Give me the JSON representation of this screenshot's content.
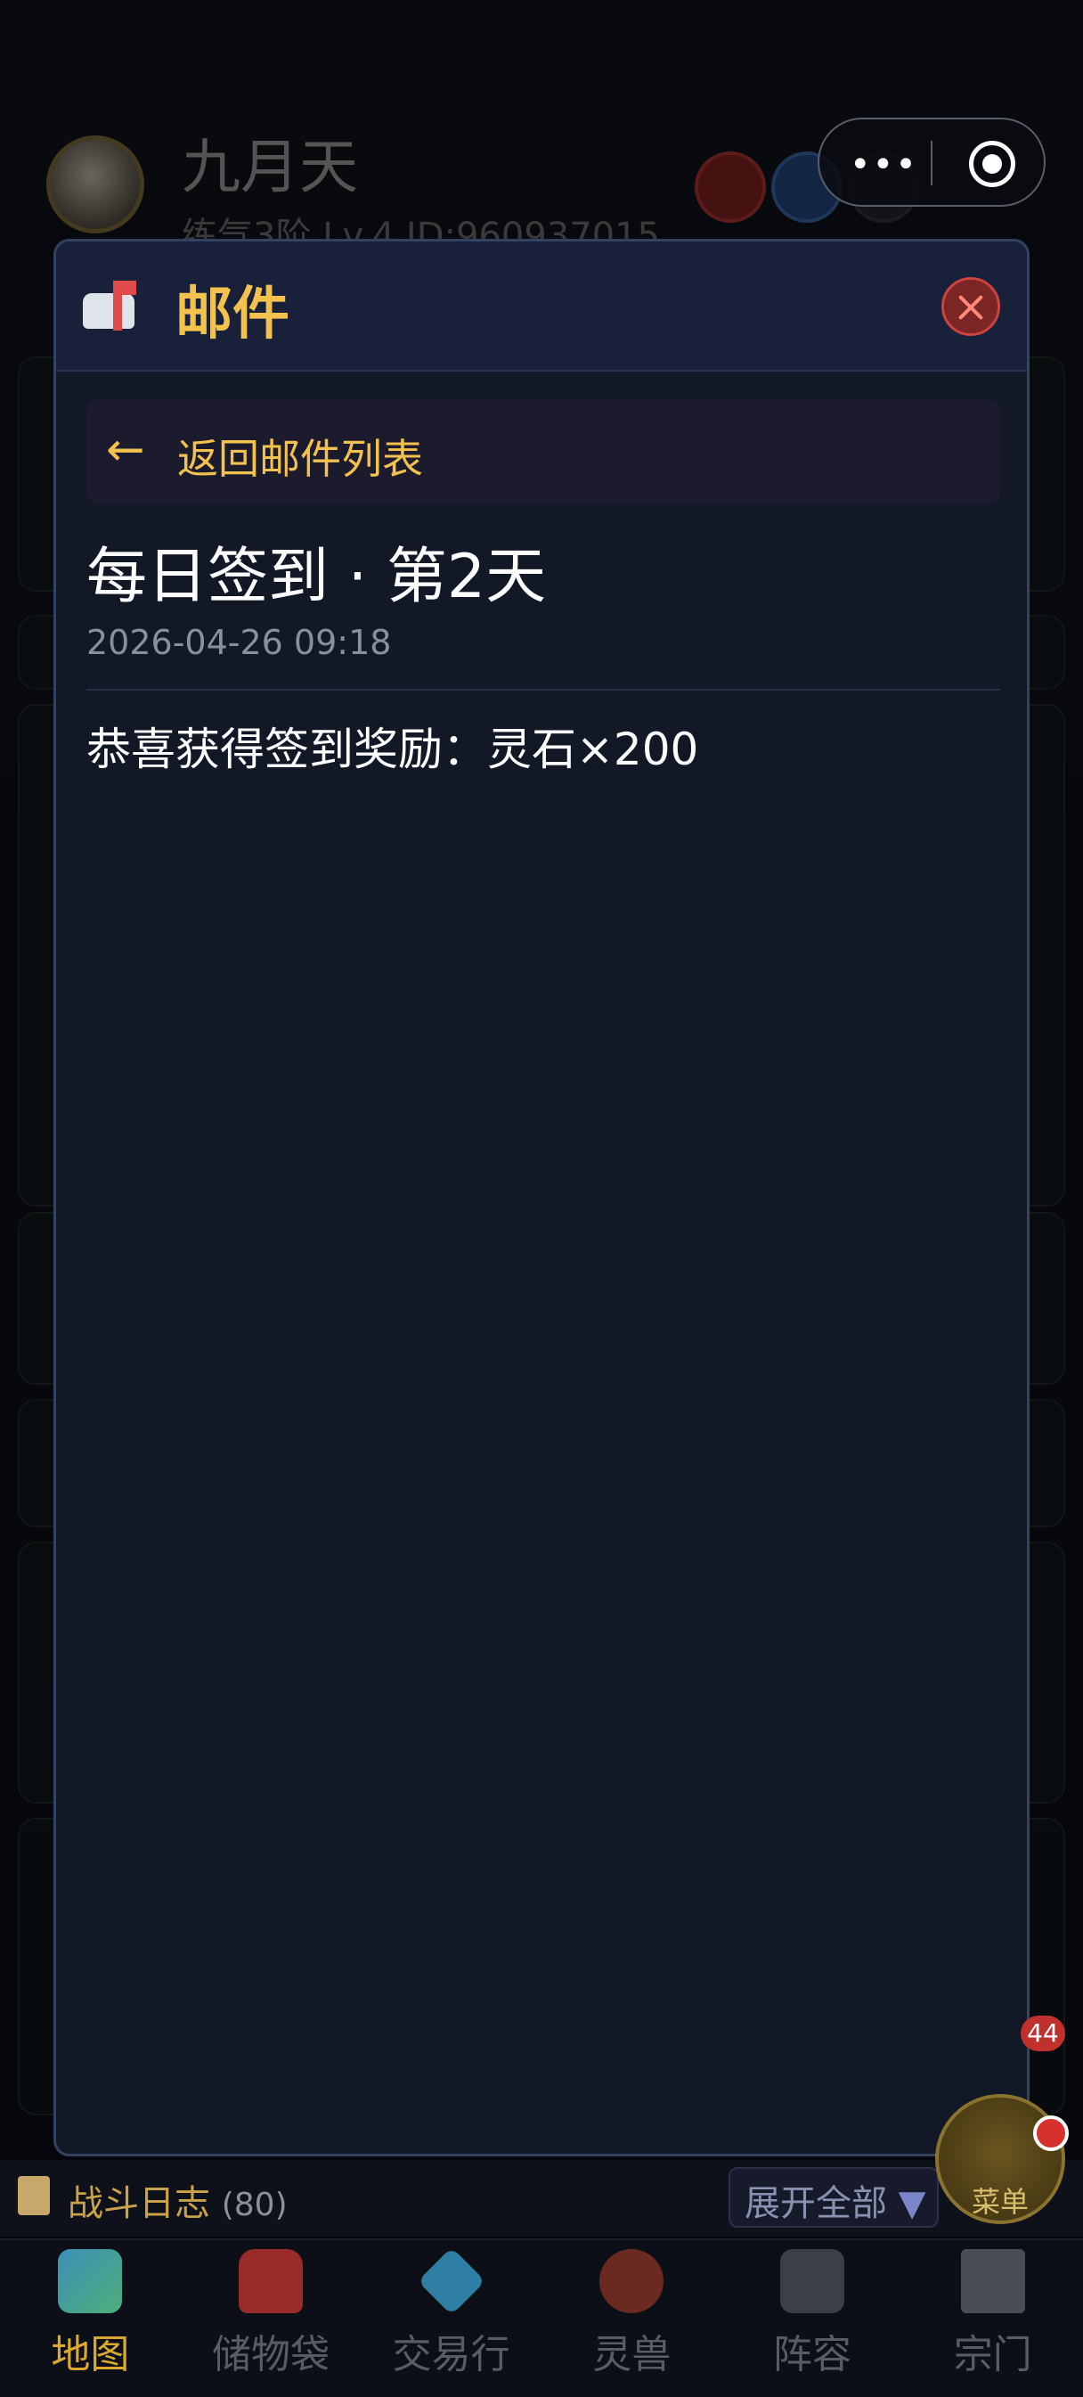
{
  "header": {
    "player_name": "九月天",
    "player_subtitle": "练气3阶 Lv.4  ID:960937015",
    "icons": [
      "gift-icon",
      "mail-icon",
      "gear-icon"
    ]
  },
  "capsule": {
    "more": "•••"
  },
  "modal": {
    "title": "邮件",
    "back_label": "返回邮件列表",
    "back_arrow": "←",
    "mail": {
      "subject": "每日签到 · 第2天",
      "date": "2026-04-26 09:18",
      "body": "恭喜获得签到奖励：灵石×200"
    }
  },
  "battle_log": {
    "title": "战斗日志",
    "count": "(80)",
    "expand_label": "展开全部",
    "expand_arrow": "▼"
  },
  "fab": {
    "label": "菜单",
    "badge": "44"
  },
  "nav": {
    "items": [
      {
        "label": "地图",
        "icon": "map-icon",
        "active": true
      },
      {
        "label": "储物袋",
        "icon": "bag-icon",
        "active": false
      },
      {
        "label": "交易行",
        "icon": "diamond-icon",
        "active": false
      },
      {
        "label": "灵兽",
        "icon": "paw-icon",
        "active": false
      },
      {
        "label": "阵容",
        "icon": "swords-icon",
        "active": false
      },
      {
        "label": "宗门",
        "icon": "temple-icon",
        "active": false
      }
    ]
  },
  "colors": {
    "accent_gold": "#f2c14e",
    "modal_bg": "#131826",
    "close_red": "#c9443f"
  }
}
